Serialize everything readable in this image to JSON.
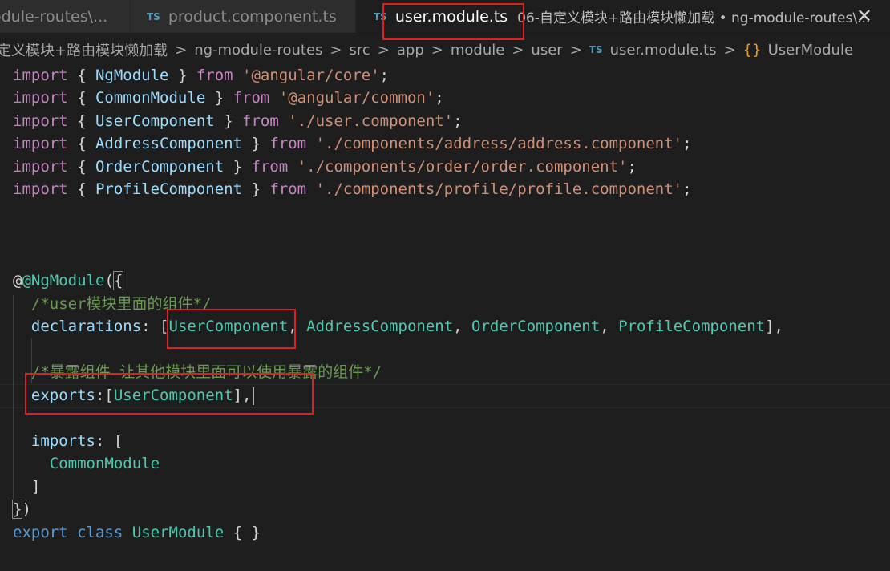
{
  "tabs": [
    {
      "label": "odule-routes\\...",
      "active": false
    },
    {
      "badge": "TS",
      "label": "product.component.ts",
      "active": false
    },
    {
      "badge": "TS",
      "label": "user.module.ts",
      "description": "06-自定义模块+路由模块懒加载 • ng-module-routes\\...",
      "active": true
    }
  ],
  "close_icon_glyph": "✕",
  "breadcrumb": {
    "items": [
      "定义模块+路由模块懒加载",
      "ng-module-routes",
      "src",
      "app",
      "module",
      "user"
    ],
    "file_badge": "TS",
    "file": "user.module.ts",
    "symbol": "UserModule",
    "separator": ">",
    "symbol_icon": "{}"
  },
  "code": {
    "kw_import": "import",
    "kw_from": "from",
    "kw_export": "export",
    "kw_class": "class",
    "imports": [
      {
        "name": "NgModule",
        "path": "'@angular/core'"
      },
      {
        "name": "CommonModule",
        "path": "'@angular/common'"
      },
      {
        "name": "UserComponent",
        "path": "'./user.component'"
      },
      {
        "name": "AddressComponent",
        "path": "'./components/address/address.component'"
      },
      {
        "name": "OrderComponent",
        "path": "'./components/order/order.component'"
      },
      {
        "name": "ProfileComponent",
        "path": "'./components/profile/profile.component'"
      }
    ],
    "decorator": "@NgModule",
    "comment_declarations": "/*user模块里面的组件*/",
    "declarations_key": "declarations",
    "declarations": [
      "UserComponent",
      "AddressComponent",
      "OrderComponent",
      "ProfileComponent"
    ],
    "comment_exports": "/*暴露组件 让其他模块里面可以使用暴露的组件*/",
    "exports_key": "exports",
    "exports": [
      "UserComponent"
    ],
    "imports_key": "imports",
    "imports_list": [
      "CommonModule"
    ],
    "class_name": "UserModule"
  },
  "colors": {
    "background": "#1e1e1e",
    "keyword": "#c586c0",
    "class": "#4ec9b0",
    "string": "#ce9178",
    "comment": "#6a9955",
    "annotation_box": "#e02020"
  }
}
